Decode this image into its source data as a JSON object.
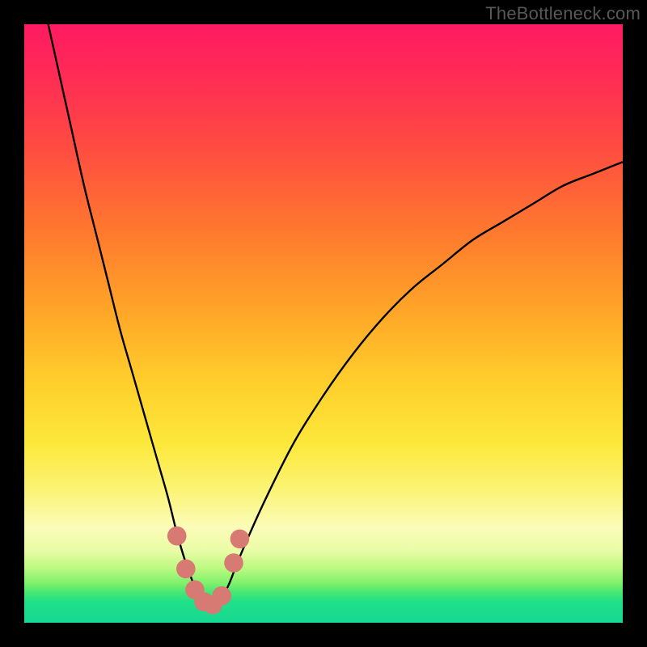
{
  "watermark": "TheBottleneck.com",
  "chart_data": {
    "type": "line",
    "title": "",
    "xlabel": "",
    "ylabel": "",
    "xlim": [
      0,
      100
    ],
    "ylim": [
      0,
      100
    ],
    "grid": false,
    "legend": false,
    "gradient_stops": [
      {
        "pos": 0,
        "color": "#ff1a62"
      },
      {
        "pos": 8,
        "color": "#ff2a56"
      },
      {
        "pos": 20,
        "color": "#ff4a42"
      },
      {
        "pos": 35,
        "color": "#ff7a2e"
      },
      {
        "pos": 48,
        "color": "#ffa628"
      },
      {
        "pos": 60,
        "color": "#ffcf2c"
      },
      {
        "pos": 70,
        "color": "#fce83a"
      },
      {
        "pos": 78,
        "color": "#fbf477"
      },
      {
        "pos": 84,
        "color": "#fbfcb8"
      },
      {
        "pos": 88,
        "color": "#e9fca6"
      },
      {
        "pos": 91,
        "color": "#baf97e"
      },
      {
        "pos": 93.5,
        "color": "#7cf06c"
      },
      {
        "pos": 95,
        "color": "#45e774"
      },
      {
        "pos": 96.5,
        "color": "#1fe088"
      },
      {
        "pos": 100,
        "color": "#17d893"
      }
    ],
    "series": [
      {
        "name": "bottleneck-curve",
        "color": "#000000",
        "x": [
          4,
          6,
          8,
          10,
          12,
          14,
          16,
          18,
          20,
          22,
          24,
          25.5,
          27,
          28.5,
          30,
          31,
          32,
          34,
          36,
          40,
          45,
          50,
          55,
          60,
          65,
          70,
          75,
          80,
          85,
          90,
          95,
          100
        ],
        "y": [
          100,
          91,
          82,
          73,
          65,
          57,
          49,
          42,
          35,
          28,
          21,
          15,
          10,
          6,
          3,
          2,
          3,
          6,
          11,
          20,
          30,
          38,
          45,
          51,
          56,
          60,
          64,
          67,
          70,
          73,
          75,
          77
        ]
      }
    ],
    "markers": [
      {
        "name": "marker-1",
        "x": 25.5,
        "y": 14.5,
        "r": 1.6,
        "color": "#d77a74"
      },
      {
        "name": "marker-2",
        "x": 27.0,
        "y": 9.0,
        "r": 1.6,
        "color": "#d77a74"
      },
      {
        "name": "marker-3",
        "x": 28.5,
        "y": 5.5,
        "r": 1.6,
        "color": "#d77a74"
      },
      {
        "name": "marker-4",
        "x": 30.0,
        "y": 3.5,
        "r": 1.6,
        "color": "#d77a74"
      },
      {
        "name": "marker-5",
        "x": 31.5,
        "y": 3.0,
        "r": 1.6,
        "color": "#d77a74"
      },
      {
        "name": "marker-6",
        "x": 33.0,
        "y": 4.5,
        "r": 1.6,
        "color": "#d77a74"
      },
      {
        "name": "marker-7",
        "x": 35.0,
        "y": 10.0,
        "r": 1.6,
        "color": "#d77a74"
      },
      {
        "name": "marker-8",
        "x": 36.0,
        "y": 14.0,
        "r": 1.6,
        "color": "#d77a74"
      }
    ]
  }
}
